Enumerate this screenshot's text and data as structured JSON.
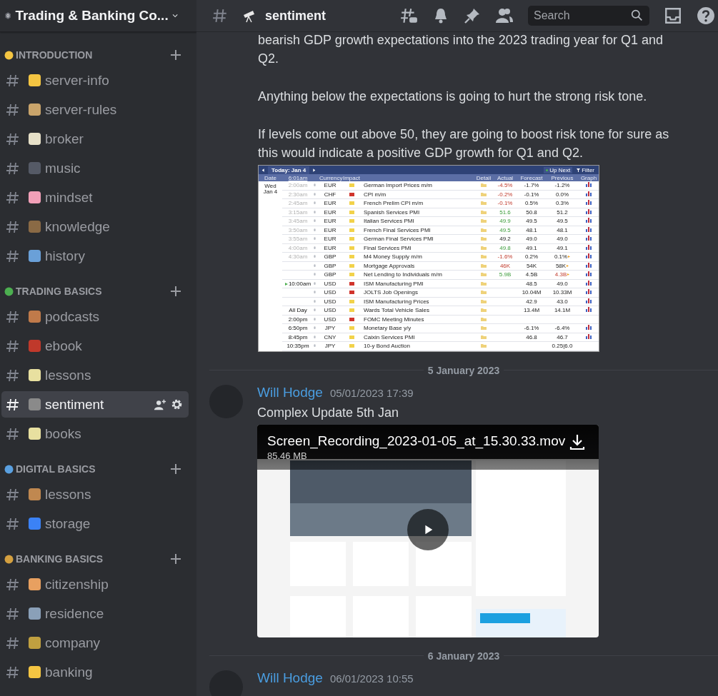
{
  "server": {
    "name": "Trading & Banking Co..."
  },
  "categories": [
    {
      "name": "INTRODUCTION",
      "channels": [
        {
          "name": "server-info",
          "selected": false
        },
        {
          "name": "server-rules",
          "selected": false
        },
        {
          "name": "broker",
          "selected": false
        },
        {
          "name": "music",
          "selected": false
        },
        {
          "name": "mindset",
          "selected": false
        },
        {
          "name": "knowledge",
          "selected": false
        },
        {
          "name": "history",
          "selected": false
        }
      ]
    },
    {
      "name": "TRADING BASICS",
      "channels": [
        {
          "name": "podcasts",
          "selected": false
        },
        {
          "name": "ebook",
          "selected": false
        },
        {
          "name": "lessons",
          "selected": false
        },
        {
          "name": "sentiment",
          "selected": true
        },
        {
          "name": "books",
          "selected": false
        }
      ]
    },
    {
      "name": "DIGITAL BASICS",
      "channels": [
        {
          "name": "lessons",
          "selected": false
        },
        {
          "name": "storage",
          "selected": false
        }
      ]
    },
    {
      "name": "BANKING BASICS",
      "channels": [
        {
          "name": "citizenship",
          "selected": false
        },
        {
          "name": "residence",
          "selected": false
        },
        {
          "name": "company",
          "selected": false
        },
        {
          "name": "banking",
          "selected": false
        }
      ]
    }
  ],
  "header": {
    "channel": "sentiment",
    "search": {
      "placeholder": "Search"
    }
  },
  "intro_paragraphs": [
    "bearish GDP growth expectations into the 2023 trading year for Q1 and Q2.",
    "Anything below the expectations is going to hurt the strong risk tone.",
    "If levels come out above 50, they are going to boost risk tone for sure as this would indicate a positive GDP growth for Q1 and Q2."
  ],
  "calendar": {
    "today": "Today: Jan 4",
    "up_next": "Up Next",
    "filter": "Filter",
    "columns": [
      "Date",
      "6:01am",
      "Currency",
      "Impact",
      "Detail",
      "Actual",
      "Forecast",
      "Previous",
      "Graph"
    ],
    "rows": [
      {
        "day": "Wed",
        "date": "Jan 4",
        "time": "2:00am",
        "past": true,
        "next": false,
        "currency": "EUR",
        "high_impact": false,
        "event": "German Import Prices m/m",
        "actual": "-4.5%",
        "beat": false,
        "missed": true,
        "forecast": "-1.7%",
        "previous": "-1.2%",
        "previous_worse": false,
        "revised": false,
        "graph": true
      },
      {
        "time": "2:30am",
        "past": true,
        "next": false,
        "currency": "CHF",
        "high_impact": true,
        "event": "CPI m/m",
        "actual": "-0.2%",
        "beat": false,
        "missed": true,
        "forecast": "-0.1%",
        "previous": "0.0%",
        "previous_worse": false,
        "revised": false,
        "graph": true
      },
      {
        "time": "2:45am",
        "past": true,
        "next": false,
        "currency": "EUR",
        "high_impact": false,
        "event": "French Prelim CPI m/m",
        "actual": "-0.1%",
        "beat": false,
        "missed": true,
        "forecast": "0.5%",
        "previous": "0.3%",
        "previous_worse": false,
        "revised": false,
        "graph": true
      },
      {
        "time": "3:15am",
        "past": true,
        "next": false,
        "currency": "EUR",
        "high_impact": false,
        "event": "Spanish Services PMI",
        "actual": "51.6",
        "beat": true,
        "missed": false,
        "forecast": "50.8",
        "previous": "51.2",
        "previous_worse": false,
        "revised": false,
        "graph": true
      },
      {
        "time": "3:45am",
        "past": true,
        "next": false,
        "currency": "EUR",
        "high_impact": false,
        "event": "Italian Services PMI",
        "actual": "49.9",
        "beat": true,
        "missed": false,
        "forecast": "49.5",
        "previous": "49.5",
        "previous_worse": false,
        "revised": false,
        "graph": true
      },
      {
        "time": "3:50am",
        "past": true,
        "next": false,
        "currency": "EUR",
        "high_impact": false,
        "event": "French Final Services PMI",
        "actual": "49.5",
        "beat": true,
        "missed": false,
        "forecast": "48.1",
        "previous": "48.1",
        "previous_worse": false,
        "revised": false,
        "graph": true
      },
      {
        "time": "3:55am",
        "past": true,
        "next": false,
        "currency": "EUR",
        "high_impact": false,
        "event": "German Final Services PMI",
        "actual": "49.2",
        "beat": false,
        "missed": false,
        "forecast": "49.0",
        "previous": "49.0",
        "previous_worse": false,
        "revised": false,
        "graph": true
      },
      {
        "time": "4:00am",
        "past": true,
        "next": false,
        "currency": "EUR",
        "high_impact": false,
        "event": "Final Services PMI",
        "actual": "49.8",
        "beat": true,
        "missed": false,
        "forecast": "49.1",
        "previous": "49.1",
        "previous_worse": false,
        "revised": false,
        "graph": true
      },
      {
        "time": "4:30am",
        "past": true,
        "next": false,
        "currency": "GBP",
        "high_impact": false,
        "event": "M4 Money Supply m/m",
        "actual": "-1.6%",
        "beat": false,
        "missed": true,
        "forecast": "0.2%",
        "previous": "0.1%",
        "previous_worse": false,
        "revised": true,
        "graph": true
      },
      {
        "currency": "GBP",
        "high_impact": false,
        "event": "Mortgage Approvals",
        "actual": "46K",
        "beat": false,
        "missed": true,
        "forecast": "54K",
        "previous": "58K",
        "previous_worse": false,
        "revised": true,
        "graph": true
      },
      {
        "currency": "GBP",
        "high_impact": false,
        "event": "Net Lending to Individuals m/m",
        "actual": "5.9B",
        "beat": true,
        "missed": false,
        "forecast": "4.5B",
        "previous": "4.3B",
        "previous_worse": true,
        "revised": true,
        "graph": true
      },
      {
        "time": "10:00am",
        "past": false,
        "next": true,
        "currency": "USD",
        "high_impact": true,
        "event": "ISM Manufacturing PMI",
        "forecast": "48.5",
        "previous": "49.0",
        "previous_worse": false,
        "revised": false,
        "graph": true
      },
      {
        "currency": "USD",
        "high_impact": true,
        "event": "JOLTS Job Openings",
        "forecast": "10.04M",
        "previous": "10.33M",
        "previous_worse": false,
        "revised": false,
        "graph": true
      },
      {
        "currency": "USD",
        "high_impact": false,
        "event": "ISM Manufacturing Prices",
        "forecast": "42.9",
        "previous": "43.0",
        "previous_worse": false,
        "revised": false,
        "graph": true
      },
      {
        "time": "All Day",
        "past": false,
        "next": false,
        "currency": "USD",
        "high_impact": false,
        "event": "Wards Total Vehicle Sales",
        "forecast": "13.4M",
        "previous": "14.1M",
        "previous_worse": false,
        "revised": false,
        "graph": true
      },
      {
        "time": "2:00pm",
        "past": false,
        "next": false,
        "currency": "USD",
        "high_impact": true,
        "event": "FOMC Meeting Minutes",
        "revised": false,
        "graph": false
      },
      {
        "time": "6:50pm",
        "past": false,
        "next": false,
        "currency": "JPY",
        "high_impact": false,
        "event": "Monetary Base y/y",
        "forecast": "-6.1%",
        "previous": "-6.4%",
        "previous_worse": false,
        "revised": false,
        "graph": true
      },
      {
        "time": "8:45pm",
        "past": false,
        "next": false,
        "currency": "CNY",
        "high_impact": false,
        "event": "Caixin Services PMI",
        "forecast": "46.8",
        "previous": "46.7",
        "previous_worse": false,
        "revised": false,
        "graph": true
      },
      {
        "time": "10:35pm",
        "past": false,
        "next": false,
        "currency": "JPY",
        "high_impact": false,
        "event": "10-y Bond Auction",
        "previous": "0.25|6.0",
        "previous_worse": false,
        "revised": false,
        "graph": false
      }
    ]
  },
  "messages": [
    {
      "divider": "5 January 2023",
      "author": "Will Hodge",
      "timestamp": "05/01/2023 17:39",
      "text": "Complex Update 5th Jan",
      "video": {
        "file": "Screen_Recording_2023-01-05_at_15.30.33.mov",
        "size": "85.46 MB"
      }
    },
    {
      "divider": "6 January 2023",
      "author": "Will Hodge",
      "timestamp": "06/01/2023 10:55"
    }
  ]
}
